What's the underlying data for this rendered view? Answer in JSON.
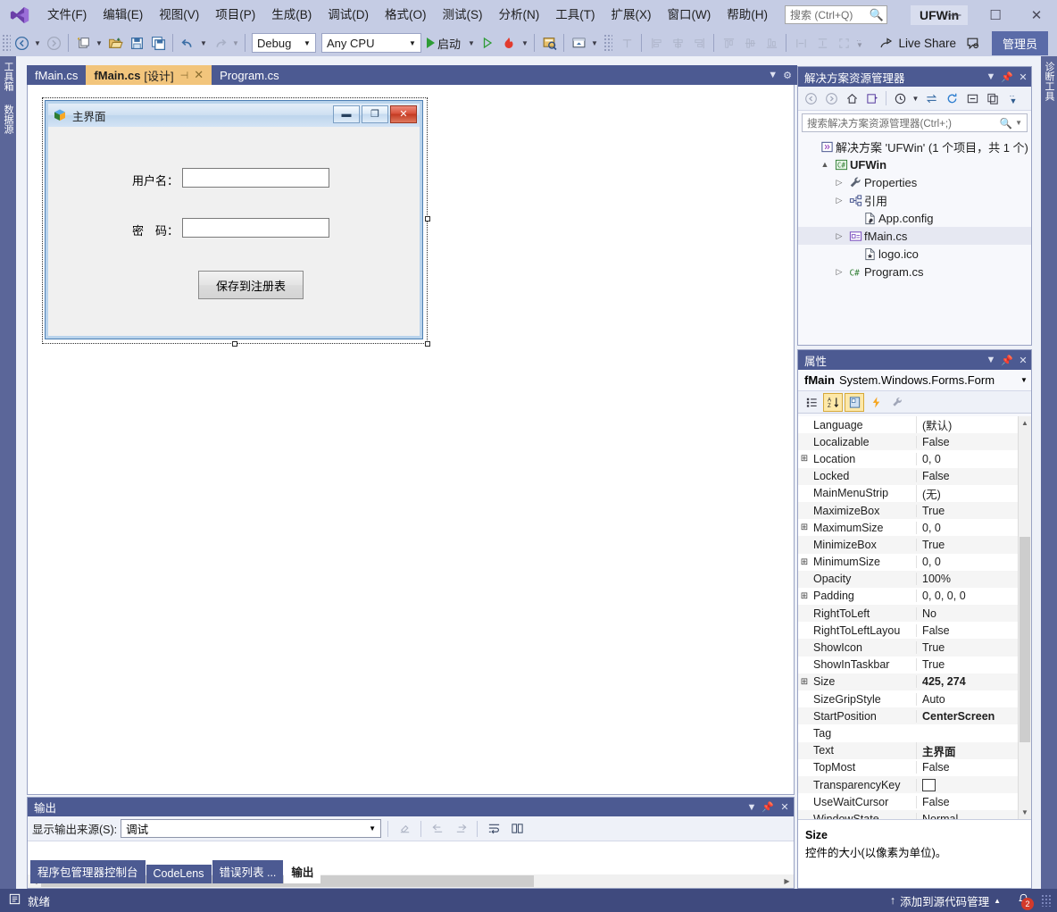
{
  "app": {
    "title": "UFWin",
    "logo_icon": "visual-studio-logo"
  },
  "menubar": {
    "items": [
      {
        "label": "文件(F)",
        "name": "menu-file"
      },
      {
        "label": "编辑(E)",
        "name": "menu-edit"
      },
      {
        "label": "视图(V)",
        "name": "menu-view"
      },
      {
        "label": "项目(P)",
        "name": "menu-project"
      },
      {
        "label": "生成(B)",
        "name": "menu-build"
      },
      {
        "label": "调试(D)",
        "name": "menu-debug"
      },
      {
        "label": "格式(O)",
        "name": "menu-format"
      },
      {
        "label": "测试(S)",
        "name": "menu-test"
      },
      {
        "label": "分析(N)",
        "name": "menu-analyze"
      },
      {
        "label": "工具(T)",
        "name": "menu-tools"
      },
      {
        "label": "扩展(X)",
        "name": "menu-extensions"
      },
      {
        "label": "窗口(W)",
        "name": "menu-window"
      },
      {
        "label": "帮助(H)",
        "name": "menu-help"
      }
    ],
    "search_placeholder": "搜索 (Ctrl+Q)",
    "search_value": "",
    "search_icon": "magnifier-icon"
  },
  "window_controls": {
    "minimize": "—",
    "maximize": "☐",
    "close": "✕"
  },
  "toolbar": {
    "nav_back_icon": "navigate-back-icon",
    "nav_forward_icon": "navigate-forward-icon",
    "new_project_icon": "new-project-icon",
    "open_file_icon": "open-file-icon",
    "save_icon": "save-icon",
    "save_all_icon": "save-all-icon",
    "undo_icon": "undo-icon",
    "redo_icon": "redo-icon",
    "config_value": "Debug",
    "platform_value": "Any CPU",
    "start_label": "启动",
    "start_icon": "start-debug-icon",
    "start_without_debug_icon": "start-without-debugging-icon",
    "hot_reload_icon": "hot-reload-icon",
    "select_icon": "select-tool-icon",
    "preview_icon": "preview-icon",
    "tab_order_icon": "tab-order-icon",
    "align_lefts_icon": "align-lefts-icon",
    "align_centers_icon": "align-centers-icon",
    "align_rights_icon": "align-rights-icon",
    "align_tops_icon": "align-tops-icon",
    "align_middles_icon": "align-middles-icon",
    "align_bottoms_icon": "align-bottoms-icon",
    "make_same_width_icon": "make-same-width-icon",
    "make_same_height_icon": "make-same-height-icon",
    "make_same_size_icon": "make-same-size-icon",
    "overflow_icon": "toolbar-overflow-icon",
    "live_share_label": "Live Share",
    "live_share_icon": "live-share-icon",
    "feedback_icon": "feedback-icon",
    "admin_label": "管理员"
  },
  "left_strip": {
    "tabs": [
      {
        "label": "工具箱",
        "name": "vertical-tab-toolbox"
      },
      {
        "label": "数据源",
        "name": "vertical-tab-data-sources"
      }
    ]
  },
  "right_strip": {
    "tabs": [
      {
        "label": "诊断工具",
        "name": "vertical-tab-diagnostic-tools"
      }
    ]
  },
  "editor_tabs": {
    "tabs": [
      {
        "label": "fMain.cs",
        "suffix": "",
        "active": false,
        "name": "editor-tab-fmain-cs"
      },
      {
        "label": "fMain.cs",
        "suffix": "[设计]",
        "active": true,
        "name": "editor-tab-fmain-designer"
      },
      {
        "label": "Program.cs",
        "suffix": "",
        "active": false,
        "name": "editor-tab-program-cs"
      }
    ],
    "pin_icon": "pin-icon",
    "close_icon": "close-icon",
    "dropdown_icon": "chevron-down-icon",
    "settings_icon": "gear-icon"
  },
  "designer": {
    "form": {
      "title": "主界面",
      "icon": "form-app-icon",
      "minimize_glyph": "▬",
      "maximize_glyph": "❐",
      "close_glyph": "✕",
      "labels": [
        {
          "text": "用户名：",
          "name": "label-username"
        },
        {
          "text": "密　码：",
          "name": "label-password"
        }
      ],
      "textboxes": [
        {
          "value": "",
          "name": "textbox-username"
        },
        {
          "value": "",
          "name": "textbox-password"
        }
      ],
      "button": {
        "text": "保存到注册表",
        "name": "button-save-to-registry"
      }
    }
  },
  "solution_explorer": {
    "title": "解决方案资源管理器",
    "dropdown_icon": "chevron-down-icon",
    "pin_icon": "pin-icon",
    "close_icon": "close-icon",
    "toolbar_icons": [
      "back-icon",
      "forward-icon",
      "home-icon",
      "switch-views-icon",
      "pending-changes-icon",
      "sync-with-active-document-icon",
      "refresh-icon",
      "collapse-all-icon",
      "show-all-files-icon",
      "overflow-icon"
    ],
    "search_placeholder": "搜索解决方案资源管理器(Ctrl+;)",
    "search_value": "",
    "search_icon": "magnifier-icon",
    "tree": [
      {
        "label": "解决方案 'UFWin' (1 个项目，共 1 个)",
        "indent": 0,
        "twisty": "",
        "icon": "solution-icon",
        "bold": false,
        "selected": false,
        "name": "tree-item-solution"
      },
      {
        "label": "UFWin",
        "indent": 1,
        "twisty": "▲",
        "icon": "csharp-project-icon",
        "bold": true,
        "selected": false,
        "name": "tree-item-project-ufwin"
      },
      {
        "label": "Properties",
        "indent": 2,
        "twisty": "▷",
        "icon": "properties-wrench-icon",
        "bold": false,
        "selected": false,
        "name": "tree-item-properties"
      },
      {
        "label": "引用",
        "indent": 2,
        "twisty": "▷",
        "icon": "references-icon",
        "bold": false,
        "selected": false,
        "name": "tree-item-references"
      },
      {
        "label": "App.config",
        "indent": 3,
        "twisty": "",
        "icon": "config-file-icon",
        "bold": false,
        "selected": false,
        "name": "tree-item-app-config"
      },
      {
        "label": "fMain.cs",
        "indent": 2,
        "twisty": "▷",
        "icon": "form-file-icon",
        "bold": false,
        "selected": true,
        "name": "tree-item-fmain-cs"
      },
      {
        "label": "logo.ico",
        "indent": 3,
        "twisty": "",
        "icon": "icon-file-icon",
        "bold": false,
        "selected": false,
        "name": "tree-item-logo-ico"
      },
      {
        "label": "Program.cs",
        "indent": 2,
        "twisty": "▷",
        "icon": "csharp-file-icon",
        "bold": false,
        "selected": false,
        "name": "tree-item-program-cs"
      }
    ]
  },
  "properties": {
    "title": "属性",
    "dropdown_icon": "chevron-down-icon",
    "pin_icon": "pin-icon",
    "close_icon": "close-icon",
    "object_name": "fMain",
    "object_type": "System.Windows.Forms.Form",
    "object_dropdown_icon": "chevron-down-icon",
    "toolbar": [
      {
        "icon": "categorized-view-icon",
        "active": false,
        "disabled": false,
        "name": "properties-categorized-button"
      },
      {
        "icon": "alphabetical-sort-icon",
        "active": true,
        "disabled": false,
        "name": "properties-alphabetical-button"
      },
      {
        "icon": "properties-page-icon",
        "active": true,
        "disabled": false,
        "name": "properties-page-button"
      },
      {
        "icon": "events-lightning-icon",
        "active": false,
        "disabled": false,
        "name": "properties-events-button"
      },
      {
        "icon": "property-pages-wrench-icon",
        "active": false,
        "disabled": true,
        "name": "properties-pages-button"
      }
    ],
    "rows": [
      {
        "expandable": false,
        "name": "Language",
        "value": "(默认)",
        "bold": false
      },
      {
        "expandable": false,
        "name": "Localizable",
        "value": "False",
        "bold": false
      },
      {
        "expandable": true,
        "name": "Location",
        "value": "0, 0",
        "bold": false
      },
      {
        "expandable": false,
        "name": "Locked",
        "value": "False",
        "bold": false
      },
      {
        "expandable": false,
        "name": "MainMenuStrip",
        "value": "(无)",
        "bold": false
      },
      {
        "expandable": false,
        "name": "MaximizeBox",
        "value": "True",
        "bold": false
      },
      {
        "expandable": true,
        "name": "MaximumSize",
        "value": "0, 0",
        "bold": false
      },
      {
        "expandable": false,
        "name": "MinimizeBox",
        "value": "True",
        "bold": false
      },
      {
        "expandable": true,
        "name": "MinimumSize",
        "value": "0, 0",
        "bold": false
      },
      {
        "expandable": false,
        "name": "Opacity",
        "value": "100%",
        "bold": false
      },
      {
        "expandable": true,
        "name": "Padding",
        "value": "0, 0, 0, 0",
        "bold": false
      },
      {
        "expandable": false,
        "name": "RightToLeft",
        "value": "No",
        "bold": false
      },
      {
        "expandable": false,
        "name": "RightToLeftLayou",
        "value": "False",
        "bold": false
      },
      {
        "expandable": false,
        "name": "ShowIcon",
        "value": "True",
        "bold": false
      },
      {
        "expandable": false,
        "name": "ShowInTaskbar",
        "value": "True",
        "bold": false
      },
      {
        "expandable": true,
        "name": "Size",
        "value": "425, 274",
        "bold": true
      },
      {
        "expandable": false,
        "name": "SizeGripStyle",
        "value": "Auto",
        "bold": false
      },
      {
        "expandable": false,
        "name": "StartPosition",
        "value": "CenterScreen",
        "bold": true
      },
      {
        "expandable": false,
        "name": "Tag",
        "value": "",
        "bold": false
      },
      {
        "expandable": false,
        "name": "Text",
        "value": "主界面",
        "bold": true
      },
      {
        "expandable": false,
        "name": "TopMost",
        "value": "False",
        "bold": false
      },
      {
        "expandable": false,
        "name": "TransparencyKey",
        "value": "",
        "swatch": "#ffffff",
        "bold": false
      },
      {
        "expandable": false,
        "name": "UseWaitCursor",
        "value": "False",
        "bold": false
      },
      {
        "expandable": false,
        "name": "WindowState",
        "value": "Normal",
        "bold": false
      }
    ],
    "description": {
      "title": "Size",
      "text": "控件的大小(以像素为单位)。"
    }
  },
  "output": {
    "title": "输出",
    "dropdown_icon": "chevron-down-icon",
    "pin_icon": "pin-icon",
    "close_icon": "close-icon",
    "source_label": "显示输出来源(S):",
    "source_value": "调试",
    "source_dropdown_icon": "chevron-down-icon",
    "toolbar_icons": [
      "clear-all-icon",
      "go-to-previous-message-icon",
      "go-to-next-message-icon",
      "toggle-word-wrap-icon",
      "show-output-from-icon"
    ],
    "body_text": ""
  },
  "dock_tabs": {
    "tabs": [
      {
        "label": "程序包管理器控制台",
        "active": false,
        "name": "dock-tab-package-manager-console"
      },
      {
        "label": "CodeLens",
        "active": false,
        "name": "dock-tab-codelens"
      },
      {
        "label": "错误列表 ...",
        "active": false,
        "name": "dock-tab-error-list"
      },
      {
        "label": "输出",
        "active": true,
        "name": "dock-tab-output"
      }
    ]
  },
  "statusbar": {
    "ready_label": "就绪",
    "ready_icon": "ready-status-icon",
    "source_control_label": "添加到源代码管理",
    "source_control_icon": "upload-arrow-icon",
    "source_control_caret": "▲",
    "notification_icon": "bell-icon",
    "notification_count": "2",
    "resize_grip_icon": "resize-grip-icon"
  }
}
